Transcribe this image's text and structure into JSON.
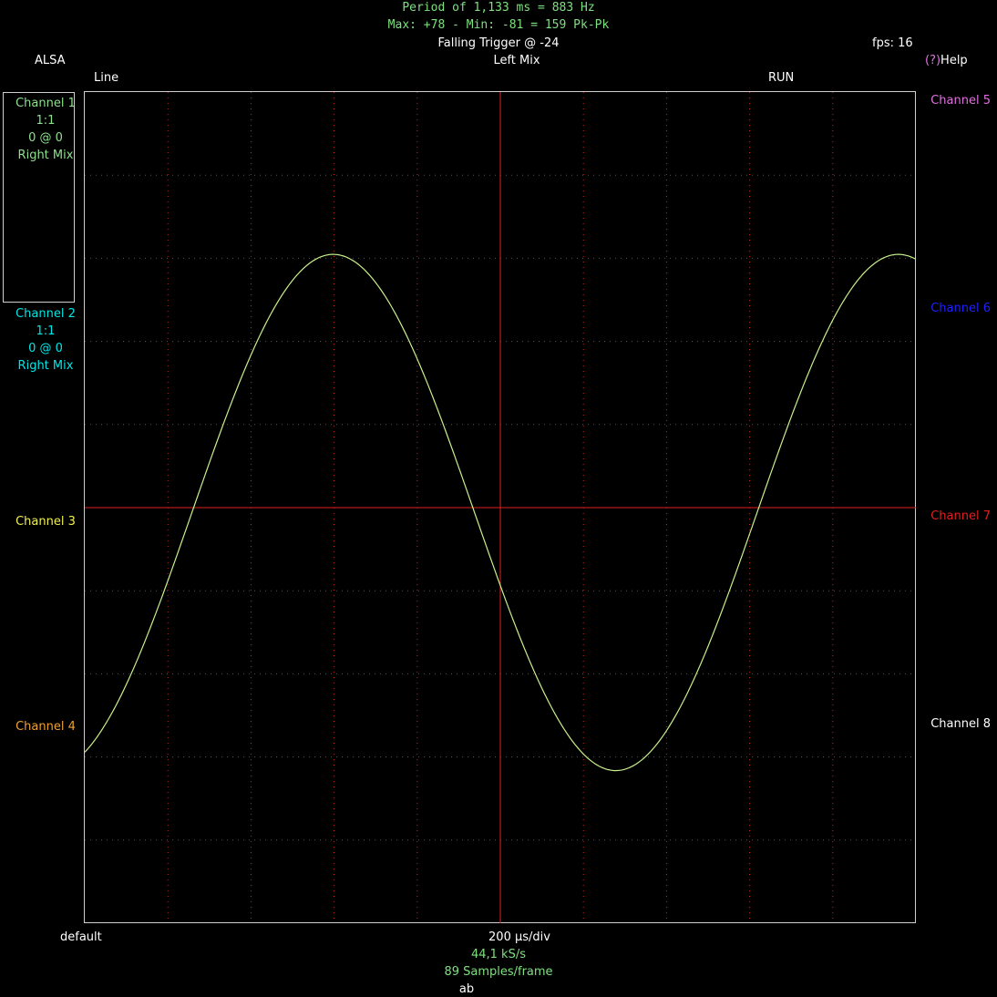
{
  "header": {
    "measure_period": "Period of 1,133 ms =   883 Hz",
    "measure_peak": "Max: +78 - Min: -81 = 159 Pk-Pk",
    "trigger": "Falling Trigger @ -24",
    "fps": "fps: 16",
    "source": "ALSA",
    "input": "Left Mix",
    "help_prefix": "(?)",
    "help_label": "Help",
    "mode": "Line",
    "state": "RUN"
  },
  "channels_left": [
    {
      "name": "Channel 1",
      "scale": "1:1",
      "offset": "0 @ 0",
      "source": "Right Mix",
      "color": "#8ee08e"
    },
    {
      "name": "Channel 2",
      "scale": "1:1",
      "offset": "0 @ 0",
      "source": "Right Mix",
      "color": "#00e5e5"
    },
    {
      "name": "Channel 3",
      "color": "#f0f050"
    },
    {
      "name": "Channel 4",
      "color": "#f0a030"
    }
  ],
  "channels_right": [
    {
      "name": "Channel 5",
      "color": "#e070e0"
    },
    {
      "name": "Channel 6",
      "color": "#2020ff"
    },
    {
      "name": "Channel 7",
      "color": "#e02020"
    },
    {
      "name": "Channel 8",
      "color": "#ffffff"
    }
  ],
  "footer": {
    "profile": "default",
    "timebase": "200 µs/div",
    "sample_rate": "44,1 kS/s",
    "samples": "89 Samples/frame",
    "label": "ab"
  },
  "trace": {
    "color": "#c8f08c",
    "grid_color": "#cc2020",
    "divisions": 10,
    "period_divisions": 6.8,
    "max": 78,
    "min": -81,
    "full_scale": 128
  }
}
